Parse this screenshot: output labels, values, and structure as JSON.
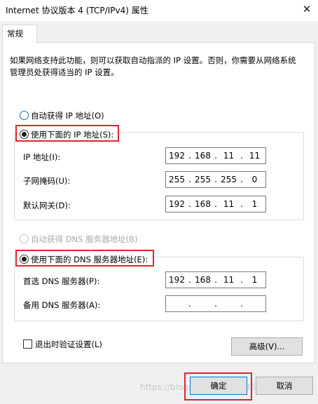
{
  "window": {
    "title": "Internet 协议版本 4 (TCP/IPv4) 属性",
    "close_glyph": "✕"
  },
  "tabs": [
    {
      "label": "常规"
    }
  ],
  "description": "如果网络支持此功能，则可以获取自动指派的 IP 设置。否则，你需要从网络系统管理员处获得适当的 IP 设置。",
  "ip_section": {
    "auto_label": "自动获得 IP 地址(O)",
    "manual_label": "使用下面的 IP 地址(S):",
    "fields": [
      {
        "label": "IP 地址(I):",
        "octets": [
          "192",
          "168",
          "11",
          "11"
        ]
      },
      {
        "label": "子网掩码(U):",
        "octets": [
          "255",
          "255",
          "255",
          "0"
        ]
      },
      {
        "label": "默认网关(D):",
        "octets": [
          "192",
          "168",
          "11",
          "1"
        ]
      }
    ]
  },
  "dns_section": {
    "auto_label": "自动获得 DNS 服务器地址(B)",
    "manual_label": "使用下面的 DNS 服务器地址(E):",
    "fields": [
      {
        "label": "首选 DNS 服务器(P):",
        "octets": [
          "192",
          "168",
          "11",
          "1"
        ]
      },
      {
        "label": "备用 DNS 服务器(A):",
        "octets": [
          "",
          "",
          "",
          ""
        ]
      }
    ]
  },
  "validate_label": "退出时验证设置(L)",
  "advanced_label": "高级(V)...",
  "ok_label": "确定",
  "cancel_label": "取消",
  "dot": ".",
  "watermark": "https://blog.csdn.net/qq_36023814",
  "colors": {
    "highlight_red": "#e3242b",
    "accent_blue": "#0078d7"
  }
}
